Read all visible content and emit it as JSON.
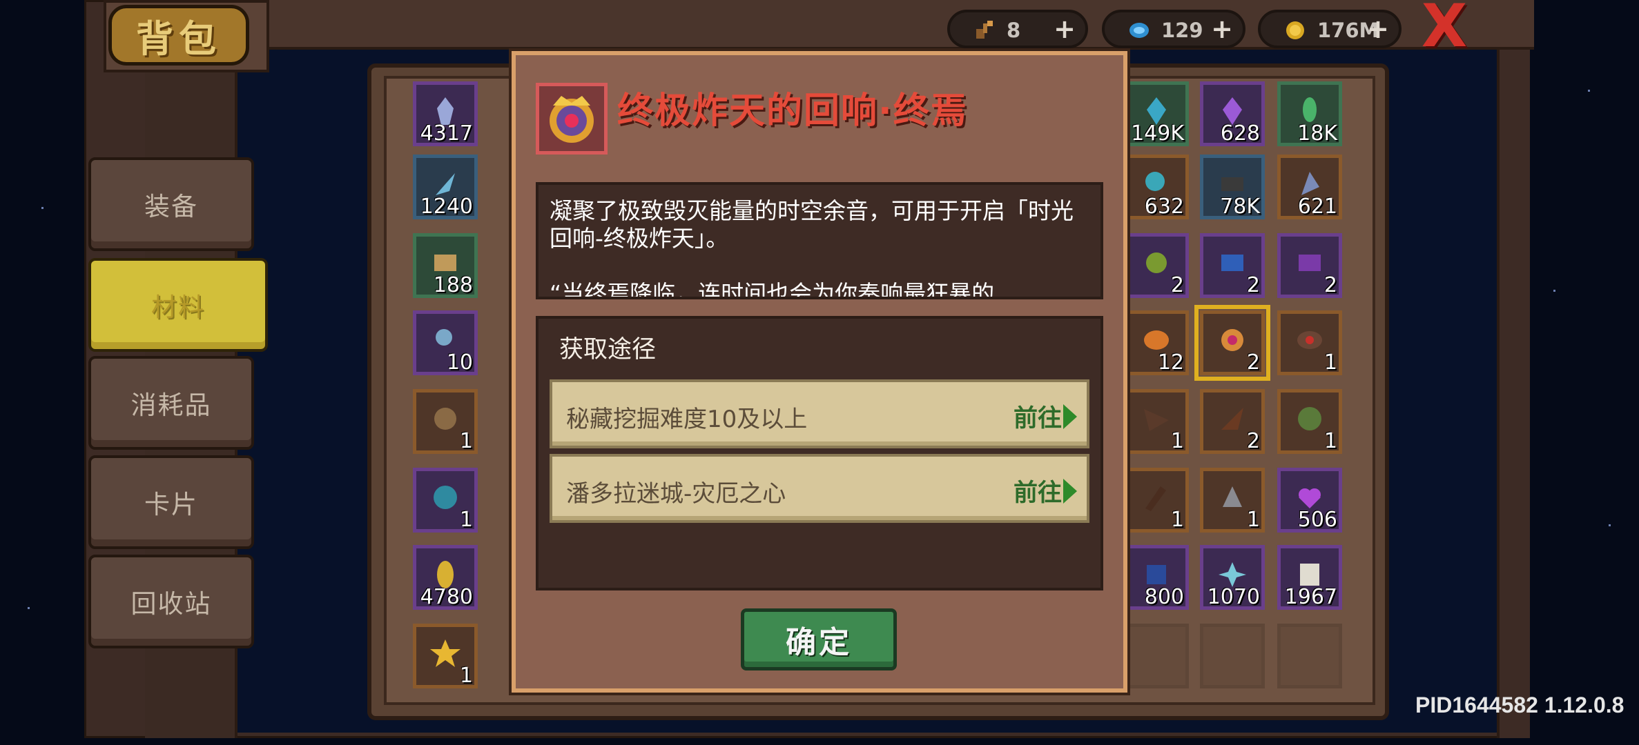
{
  "header": {
    "title": "背包"
  },
  "currencies": [
    {
      "icon": "key-icon",
      "value": "8",
      "add": "+"
    },
    {
      "icon": "gem-icon",
      "value": "129",
      "add": "+"
    },
    {
      "icon": "coin-icon",
      "value": "176M",
      "add": "+"
    }
  ],
  "close_label": "X",
  "tabs": [
    {
      "label": "装备",
      "active": false
    },
    {
      "label": "材料",
      "active": true
    },
    {
      "label": "消耗品",
      "active": false
    },
    {
      "label": "卡片",
      "active": false
    },
    {
      "label": "回收站",
      "active": false
    }
  ],
  "inventory": {
    "left_column": [
      "4317",
      "1240",
      "188",
      "10",
      "1",
      "1",
      "4780",
      "1"
    ],
    "right_columns": [
      [
        "149K",
        "628",
        "18K"
      ],
      [
        "632",
        "78K",
        "621"
      ],
      [
        "2",
        "2",
        "2"
      ],
      [
        "12",
        "2",
        "1"
      ],
      [
        "1",
        "2",
        "1"
      ],
      [
        "1",
        "1",
        "506"
      ],
      [
        "800",
        "1070",
        "1967"
      ]
    ]
  },
  "modal": {
    "item_name": "终极炸天的回响·终焉",
    "description": "凝聚了极致毁灭能量的时空余音，可用于开启「时光回响-终极炸天」。",
    "quote": "“当终焉降临，连时间也会为你奏响最狂暴的",
    "source_title": "获取途径",
    "routes": [
      {
        "label": "秘藏挖掘难度10及以上",
        "action": "前往"
      },
      {
        "label": "潘多拉迷城-灾厄之心",
        "action": "前往"
      }
    ],
    "confirm_label": "确定"
  },
  "version_text": "PID1644582 1.12.0.8",
  "colors": {
    "title_red": "#e54b3a",
    "confirm_green": "#3e8a50",
    "active_tab_yellow": "#d2bf3a"
  }
}
